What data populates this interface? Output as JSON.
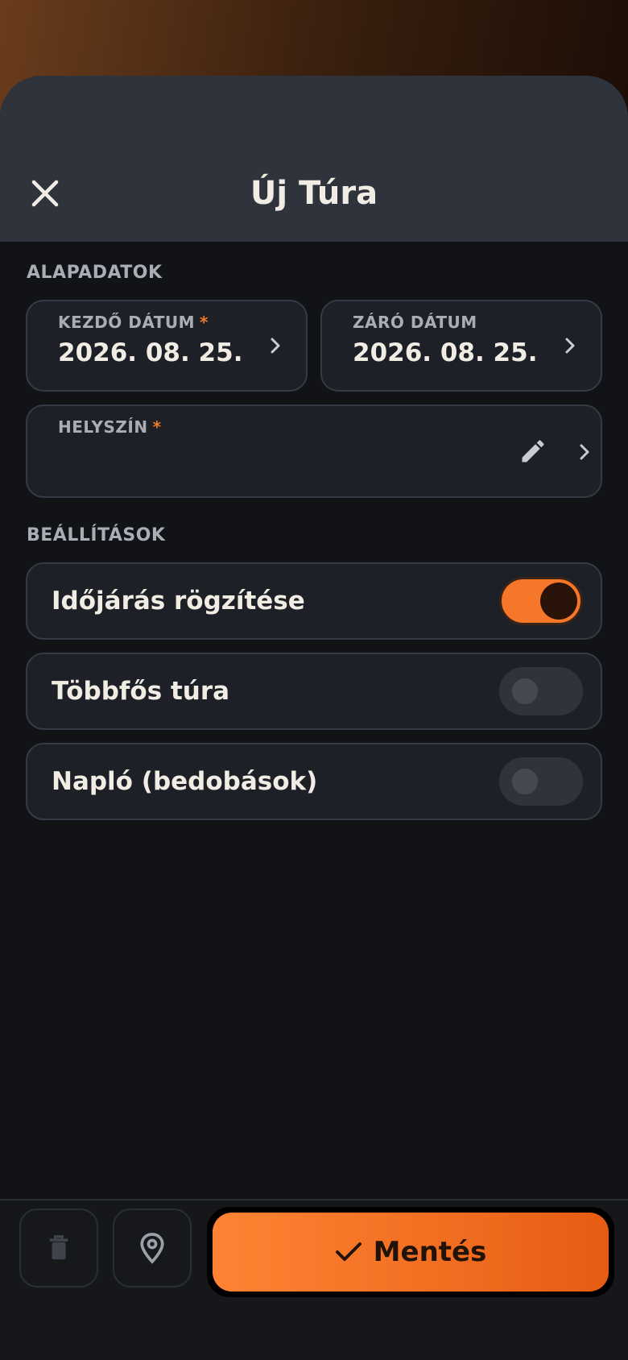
{
  "header": {
    "title": "Új Túra"
  },
  "sections": {
    "basic": "ALAPADATOK",
    "settings": "BEÁLLÍTÁSOK"
  },
  "fields": {
    "start_date": {
      "label": "KEZDŐ DÁTUM",
      "required_mark": "*",
      "value": "2026. 08. 25."
    },
    "end_date": {
      "label": "ZÁRÓ DÁTUM",
      "value": "2026. 08. 25."
    },
    "location": {
      "label": "HELYSZÍN",
      "required_mark": "*",
      "value": ""
    }
  },
  "toggles": [
    {
      "label": "Időjárás rögzítése",
      "on": true
    },
    {
      "label": "Többfős túra",
      "on": false
    },
    {
      "label": "Napló (bedobások)",
      "on": false
    }
  ],
  "bottom": {
    "save_label": "Mentés"
  },
  "colors": {
    "accent": "#f7772a",
    "background": "#121316",
    "header": "#2f333b",
    "card": "#1e2028"
  },
  "icons": [
    "close-icon",
    "chevron-right-icon",
    "pencil-icon",
    "trash-icon",
    "location-pin-icon",
    "checkmark-icon"
  ]
}
